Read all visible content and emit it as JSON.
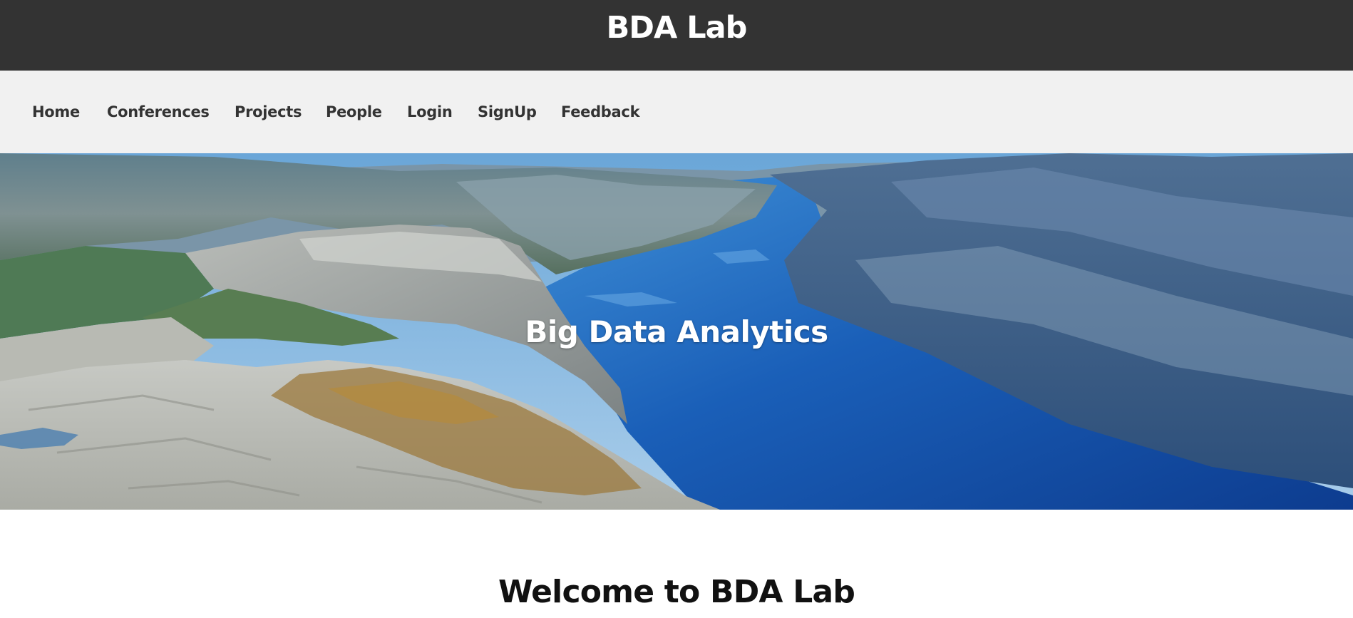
{
  "header": {
    "site_title": "BDA Lab",
    "background_color": "#333333"
  },
  "nav": {
    "background_color": "#f1f1f1",
    "items": [
      {
        "label": "Home"
      },
      {
        "label": "Conferences"
      },
      {
        "label": "Projects"
      },
      {
        "label": "People"
      },
      {
        "label": "Login"
      },
      {
        "label": "SignUp"
      },
      {
        "label": "Feedback"
      }
    ]
  },
  "hero": {
    "title": "Big Data Analytics"
  },
  "main": {
    "welcome_heading": "Welcome to BDA Lab"
  }
}
